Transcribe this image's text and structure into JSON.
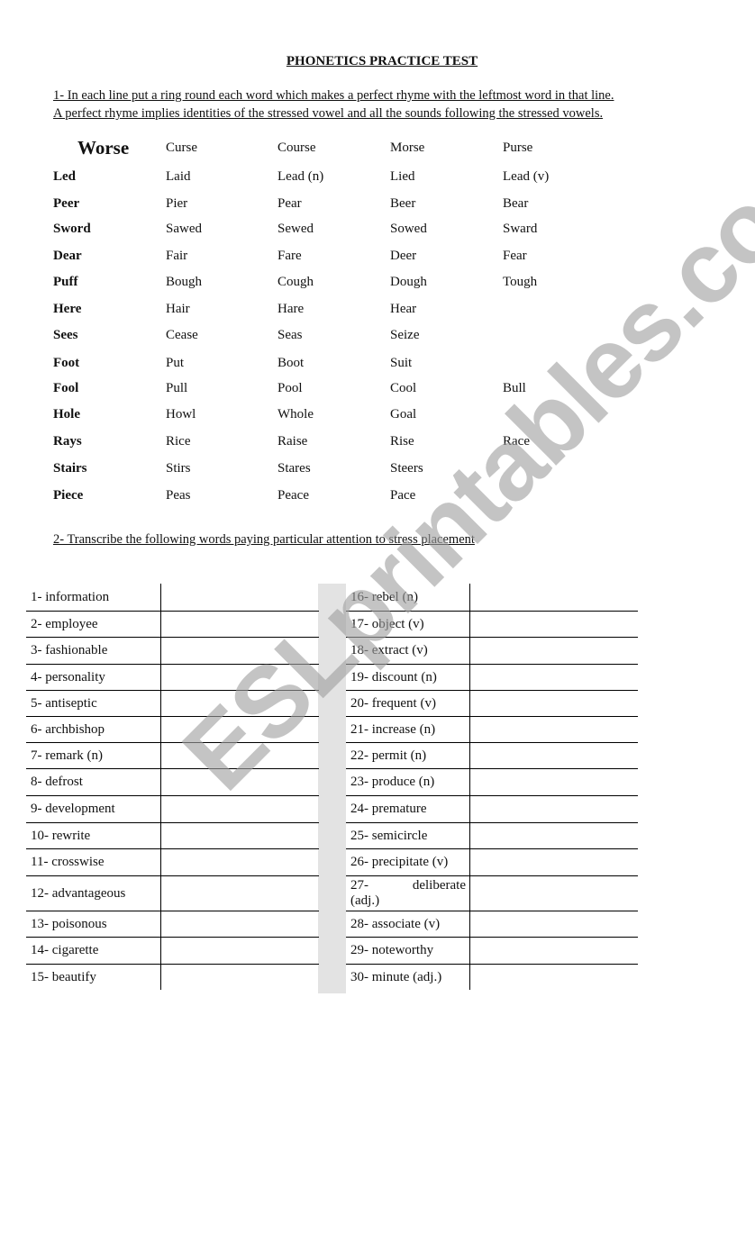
{
  "title": "PHONETICS PRACTICE TEST",
  "section1": {
    "instruction_line1": "1-  In each line put a ring round each word which makes a perfect rhyme with the leftmost word in that line.",
    "instruction_line2": "A perfect rhyme implies identities of the stressed vowel and all the sounds following the stressed vowels.",
    "rows": [
      {
        "key": "Worse",
        "options": [
          "Curse",
          "Course",
          "Morse",
          "Purse"
        ]
      },
      {
        "key": "Led",
        "options": [
          "Laid",
          "Lead (n)",
          "Lied",
          "Lead (v)"
        ]
      },
      {
        "key": "Peer",
        "options": [
          "Pier",
          "Pear",
          "Beer",
          "Bear"
        ]
      },
      {
        "key": "Sword",
        "options": [
          "Sawed",
          "Sewed",
          "Sowed",
          "Sward"
        ]
      },
      {
        "key": "Dear",
        "options": [
          "Fair",
          "Fare",
          "Deer",
          "Fear"
        ]
      },
      {
        "key": "Puff",
        "options": [
          "Bough",
          "Cough",
          "Dough",
          "Tough"
        ]
      },
      {
        "key": "Here",
        "options": [
          "Hair",
          "Hare",
          "Hear",
          ""
        ]
      },
      {
        "key": "Sees",
        "options": [
          "Cease",
          "Seas",
          "Seize",
          ""
        ]
      },
      {
        "key": "Foot",
        "options": [
          "Put",
          "Boot",
          "Suit",
          ""
        ]
      },
      {
        "key": "Fool",
        "options": [
          "Pull",
          "Pool",
          "Cool",
          "Bull"
        ]
      },
      {
        "key": "Hole",
        "options": [
          "Howl",
          "Whole",
          "Goal",
          ""
        ]
      },
      {
        "key": "Rays",
        "options": [
          "Rice",
          "Raise",
          "Rise",
          "Race"
        ]
      },
      {
        "key": "Stairs",
        "options": [
          "Stirs",
          "Stares",
          "Steers",
          ""
        ]
      },
      {
        "key": "Piece",
        "options": [
          "Peas",
          "Peace",
          "Pace",
          ""
        ]
      }
    ]
  },
  "section2": {
    "instruction": "2-  Transcribe the following words paying particular attention to stress placement",
    "left": [
      "1- information",
      "2- employee",
      "3- fashionable",
      "4- personality",
      "5- antiseptic",
      "6- archbishop",
      "7- remark (n)",
      "8- defrost",
      "9- development",
      "10- rewrite",
      "11- crosswise",
      "12- advantageous",
      "13- poisonous",
      "14- cigarette",
      "15- beautify"
    ],
    "right": [
      "16- rebel (n)",
      "17- object (v)",
      "18- extract (v)",
      "19- discount (n)",
      "20- frequent (v)",
      "21- increase (n)",
      "22- permit (n)",
      "23-  produce (n)",
      "24- premature",
      "25- semicircle",
      "26- precipitate (v)",
      "27- deliberate (adj.)",
      "28- associate (v)",
      "29- noteworthy",
      "30- minute (adj.)"
    ],
    "right_wrapped_27": {
      "part1": "27-",
      "part2": "deliberate",
      "part3": "(adj.)"
    }
  },
  "watermark": "ESLprintables.com"
}
